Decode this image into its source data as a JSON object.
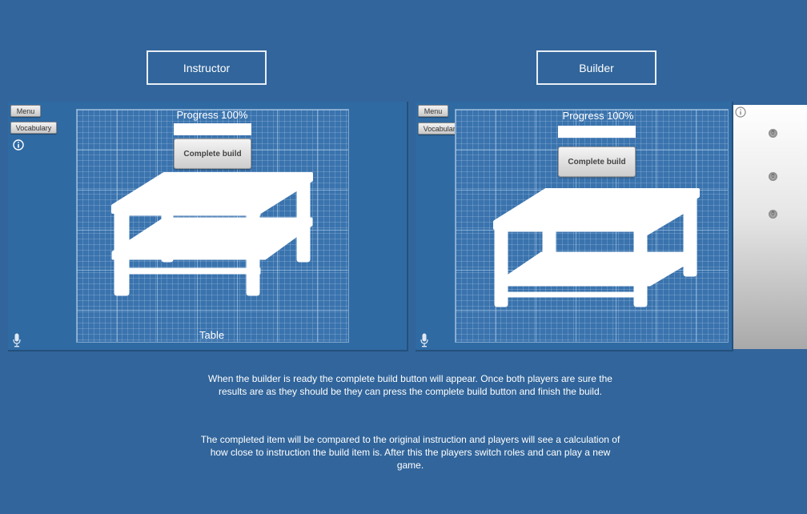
{
  "roles": {
    "instructor": "Instructor",
    "builder": "Builder"
  },
  "instructor_panel": {
    "menu_label": "Menu",
    "vocabulary_label": "Vocabulary",
    "progress_text": "Progress 100%",
    "complete_label": "Complete build",
    "item_name": "Table"
  },
  "builder_panel": {
    "menu_label": "Menu",
    "vocabulary_label": "Vocabulary",
    "progress_text": "Progress 100%",
    "complete_label": "Complete build",
    "side_controls": [
      "0",
      "0",
      "0"
    ]
  },
  "description": {
    "paragraph1": "When the builder is ready the complete build button will appear. Once both players are sure the results are as they should be they can press the complete build button and finish the build.",
    "paragraph2": "The completed item will be compared to the original instruction and players will see a calculation of how close to instruction the build item is. After this the players switch roles and can play a new game."
  },
  "icons": {
    "info": "info-icon",
    "microphone": "microphone-icon",
    "table_silhouette": "table-icon"
  },
  "colors": {
    "background": "#31659b",
    "panel": "#2f6aa3",
    "grid": "#3a73ad"
  }
}
